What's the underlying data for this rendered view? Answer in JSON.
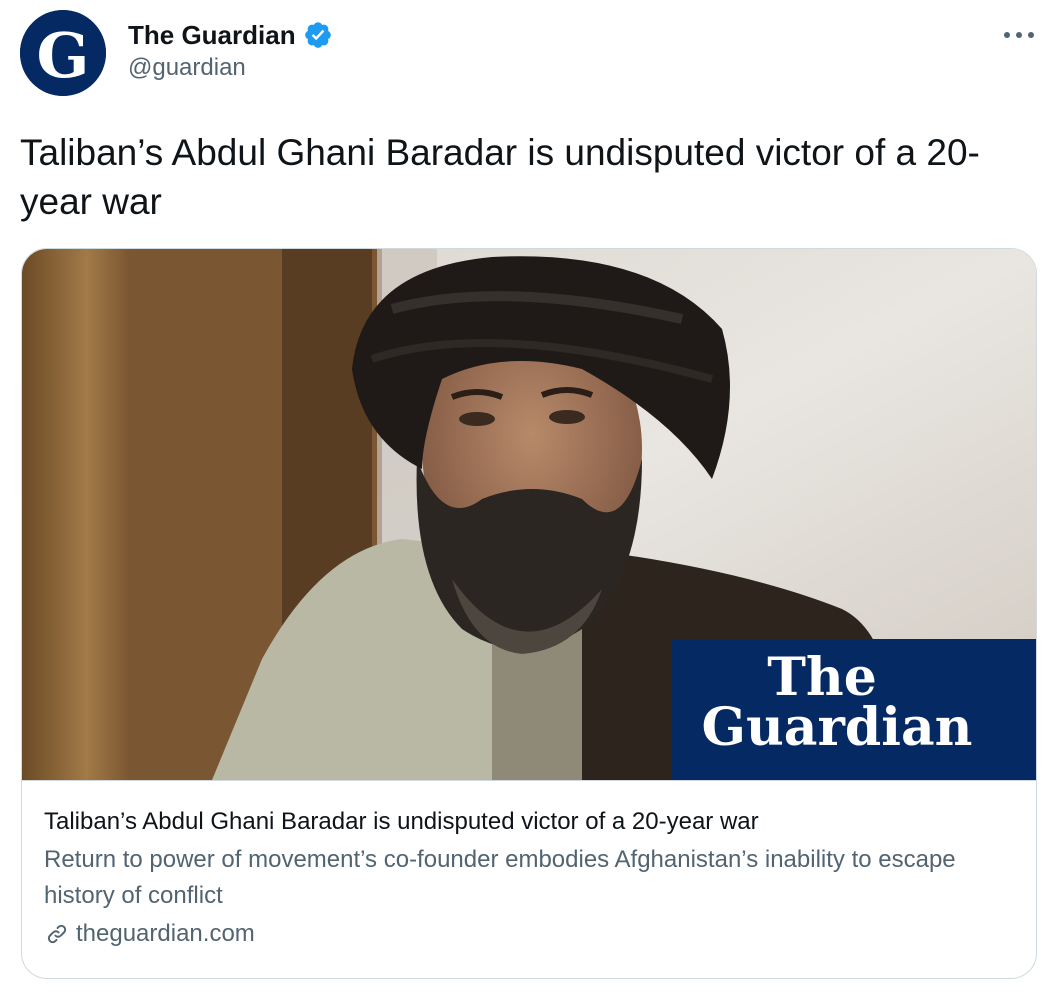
{
  "author": {
    "name": "The Guardian",
    "handle": "@guardian",
    "avatar_letter": "G",
    "verified": true
  },
  "tweet": {
    "text": "Taliban’s Abdul Ghani Baradar is undisputed victor of a 20-year war"
  },
  "card": {
    "logo_line1": "The",
    "logo_line2": "Guardian",
    "title": "Taliban’s Abdul Ghani Baradar is undisputed victor of a 20-year war",
    "description": "Return to power of movement’s co-founder embodies Afghanistan’s inability to escape history of conflict",
    "domain": "theguardian.com"
  },
  "icons": {
    "verified": "verified-badge-icon",
    "more": "more-options-icon",
    "link": "link-icon"
  },
  "colors": {
    "guardian_blue": "#052962",
    "verified_blue": "#1d9bf0",
    "text_primary": "#0f1419",
    "text_secondary": "#536471",
    "border": "#cfd9de"
  }
}
